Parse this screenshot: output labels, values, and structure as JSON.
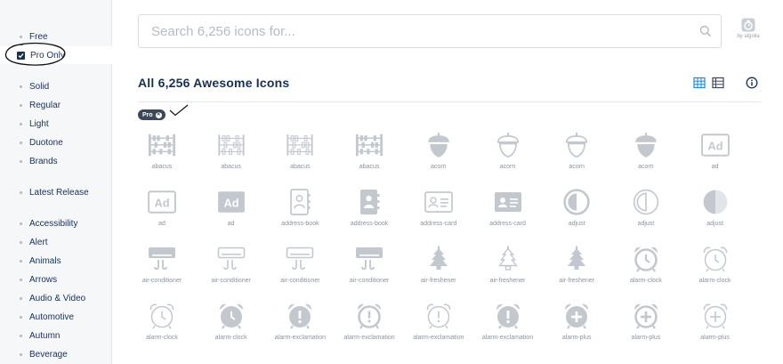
{
  "colors": {
    "icon": "#c3c8cf",
    "accent": "#1b8ad6",
    "text": "#183153"
  },
  "sidebar": {
    "license": [
      {
        "label": "Free",
        "checked": false
      },
      {
        "label": "Pro Only",
        "checked": true
      }
    ],
    "styles": [
      "Solid",
      "Regular",
      "Light",
      "Duotone",
      "Brands"
    ],
    "release": [
      "Latest Release"
    ],
    "categories": [
      "Accessibility",
      "Alert",
      "Animals",
      "Arrows",
      "Audio & Video",
      "Automotive",
      "Autumn",
      "Beverage"
    ]
  },
  "search": {
    "placeholder": "Search 6,256 icons for...",
    "value": "",
    "powered_by": "by algolia"
  },
  "main": {
    "title": "All 6,256 Awesome Icons",
    "filter_tag": "Pro",
    "icons": [
      {
        "label": "abacus",
        "icon": "abacus-icon"
      },
      {
        "label": "abacus",
        "icon": "abacus-icon"
      },
      {
        "label": "abacus",
        "icon": "abacus-icon"
      },
      {
        "label": "abacus",
        "icon": "abacus-icon"
      },
      {
        "label": "acorn",
        "icon": "acorn-icon"
      },
      {
        "label": "acorn",
        "icon": "acorn-icon"
      },
      {
        "label": "acorn",
        "icon": "acorn-icon"
      },
      {
        "label": "acorn",
        "icon": "acorn-icon"
      },
      {
        "label": "ad",
        "icon": "ad-icon"
      },
      {
        "label": "ad",
        "icon": "ad-icon"
      },
      {
        "label": "ad",
        "icon": "ad-icon"
      },
      {
        "label": "address-book",
        "icon": "address-book-icon"
      },
      {
        "label": "address-book",
        "icon": "address-book-icon"
      },
      {
        "label": "address-card",
        "icon": "address-card-icon"
      },
      {
        "label": "address-card",
        "icon": "address-card-icon"
      },
      {
        "label": "adjust",
        "icon": "adjust-icon"
      },
      {
        "label": "adjust",
        "icon": "adjust-icon"
      },
      {
        "label": "adjust",
        "icon": "adjust-icon"
      },
      {
        "label": "air-conditioner",
        "icon": "air-conditioner-icon"
      },
      {
        "label": "air-conditioner",
        "icon": "air-conditioner-icon"
      },
      {
        "label": "air-conditioner",
        "icon": "air-conditioner-icon"
      },
      {
        "label": "air-conditioner",
        "icon": "air-conditioner-icon"
      },
      {
        "label": "air-freshener",
        "icon": "air-freshener-icon"
      },
      {
        "label": "air-freshener",
        "icon": "air-freshener-icon"
      },
      {
        "label": "air-freshener",
        "icon": "air-freshener-icon"
      },
      {
        "label": "alarm-clock",
        "icon": "alarm-clock-icon"
      },
      {
        "label": "alarm-clock",
        "icon": "alarm-clock-icon"
      },
      {
        "label": "alarm-clock",
        "icon": "alarm-clock-icon"
      },
      {
        "label": "alarm-clock",
        "icon": "alarm-clock-icon"
      },
      {
        "label": "alarm-exclamation",
        "icon": "alarm-exclamation-icon"
      },
      {
        "label": "alarm-exclamation",
        "icon": "alarm-exclamation-icon"
      },
      {
        "label": "alarm-exclamation",
        "icon": "alarm-exclamation-icon"
      },
      {
        "label": "alarm-exclamation",
        "icon": "alarm-exclamation-icon"
      },
      {
        "label": "alarm-plus",
        "icon": "alarm-plus-icon"
      },
      {
        "label": "alarm-plus",
        "icon": "alarm-plus-icon"
      },
      {
        "label": "alarm-plus",
        "icon": "alarm-plus-icon"
      }
    ]
  }
}
